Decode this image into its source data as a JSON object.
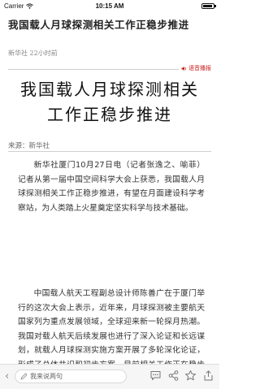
{
  "status_bar": {
    "carrier": "Carrier",
    "time": "10:15 AM"
  },
  "header": {
    "title": "我国载人月球探测相关工作正稳步推进"
  },
  "meta": {
    "source_time": "新华社 22小时前"
  },
  "font_toggle": {
    "label": "语音播报",
    "color": "#cc2222"
  },
  "article": {
    "headline_line1": "我国载人月球探测相关",
    "headline_line2": "工作正稳步推进",
    "source": "来源：新华社",
    "paragraphs": [
      "新华社厦门10月27日电（记者张逸之、喻菲）记者从第一届中国空间科学大会上获悉，我国载人月球探测相关工作正稳步推进，有望在月面建设科学考察站，为人类踏上火星奠定坚实科学与技术基础。",
      "中国载人航天工程副总设计师陈善广在于厦门举行的这次大会上表示，近年来，月球探测被主要航天国家列为重点发展领域，全球迎来新一轮探月热潮。我国对载人航天后续发展也进行了深入论证和长远谋划，就载人月球探测实施方案开展了多轮深化论证，形成了总体共识和初步方案，目前相关工作正在稳步推进。"
    ]
  },
  "bottom_bar": {
    "back_icon": "chevron-left-icon",
    "comment_placeholder": "我来说两句",
    "icons": [
      "comment-icon",
      "share-icon",
      "star-icon",
      "upload-icon"
    ]
  }
}
